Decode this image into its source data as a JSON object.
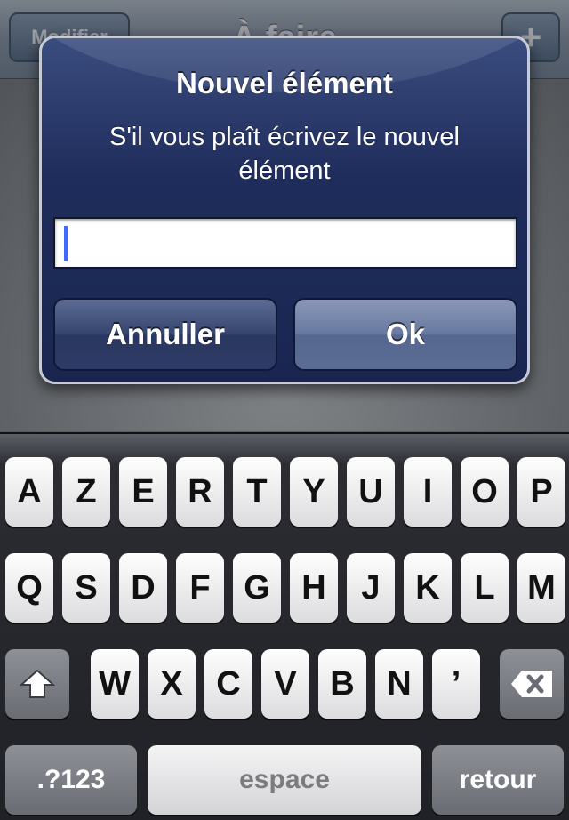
{
  "navbar": {
    "edit_label": "Modifier",
    "title": "À faire",
    "add_label": "+"
  },
  "alert": {
    "title": "Nouvel élément",
    "message": "S'il vous plaît écrivez le nouvel élément",
    "input_value": "",
    "cancel_label": "Annuller",
    "ok_label": "Ok"
  },
  "keyboard": {
    "row1": [
      "A",
      "Z",
      "E",
      "R",
      "T",
      "Y",
      "U",
      "I",
      "O",
      "P"
    ],
    "row2": [
      "Q",
      "S",
      "D",
      "F",
      "G",
      "H",
      "J",
      "K",
      "L",
      "M"
    ],
    "row3": [
      "W",
      "X",
      "C",
      "V",
      "B",
      "N",
      "’"
    ],
    "shift_icon": "shift-arrow-icon",
    "delete_icon": "backspace-icon",
    "numbers_label": ".?123",
    "space_label": "espace",
    "return_label": "retour"
  },
  "colors": {
    "alert_bg": "#1f2d5c",
    "caret": "#3d6bff",
    "keyboard_bg": "#1f2126"
  }
}
